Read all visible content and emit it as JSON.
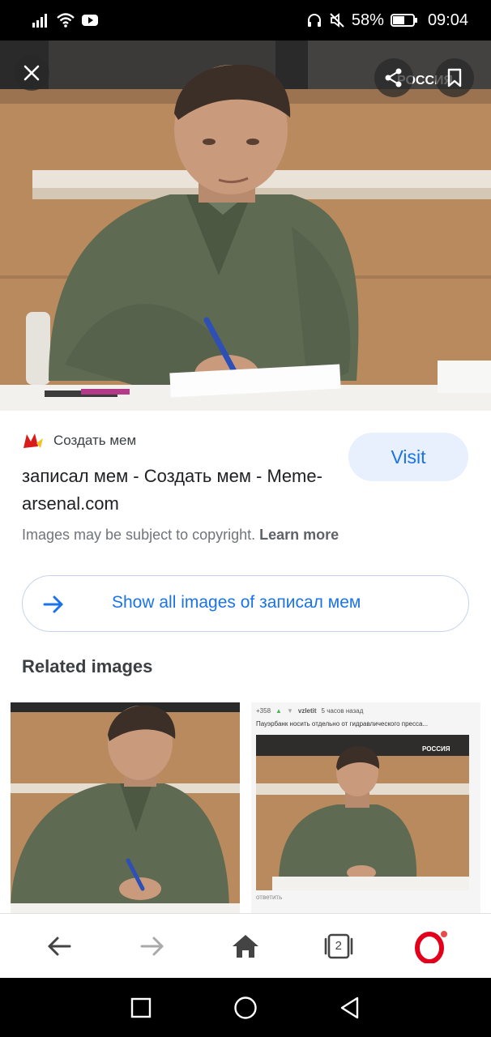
{
  "status_bar": {
    "battery": "58%",
    "time": "09:04"
  },
  "hero": {
    "close_icon": "close-icon",
    "share_icon": "share-icon",
    "bookmark_icon": "bookmark-icon",
    "watermark": "РОССИЯ"
  },
  "result": {
    "source_name": "Создать мем",
    "visit_label": "Visit",
    "title": "записал мем - Создать мем - Meme-arsenal.com",
    "copyright_text": "Images may be subject to copyright.",
    "learn_more": "Learn more",
    "show_all_label": "Show all images of записал мем",
    "related_heading": "Related images"
  },
  "related_thumb2": {
    "votes": "+358",
    "username": "vzletit",
    "time_ago": "5 часов назад",
    "caption": "Пауэрбанк носить отдельно от гидравлического пресса...",
    "reply": "ответить"
  },
  "bottom_nav": {
    "tabs_count": "2"
  },
  "colors": {
    "accent": "#1a73e8",
    "visit_bg": "#e8f0fe",
    "opera_red": "#e3001b"
  }
}
